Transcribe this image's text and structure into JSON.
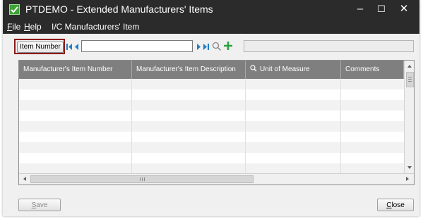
{
  "window": {
    "title": "PTDEMO - Extended Manufacturers' Items",
    "controls": {
      "minimize": "–",
      "maximize": "☐",
      "close": "✕"
    }
  },
  "menu": {
    "file_accel": "F",
    "file_rest": "ile",
    "help_accel": "H",
    "help_rest": "elp",
    "ic": "I/C Manufacturers' Item"
  },
  "toolbar": {
    "key_button": "Item Number",
    "key_value": "",
    "description_value": "",
    "icons": [
      "first-icon",
      "previous-icon",
      "next-icon",
      "last-icon",
      "search-icon",
      "add-icon"
    ]
  },
  "grid": {
    "columns": [
      "Manufacturer's Item Number",
      "Manufacturer's Item Description",
      "Unit of Measure",
      "Comments"
    ],
    "rows": []
  },
  "footer": {
    "save_accel": "S",
    "save_rest": "ave",
    "close_accel": "C",
    "close_rest": "lose"
  },
  "colors": {
    "titlebar": "#2b2b2b",
    "grid_header": "#7f7f7f",
    "highlight_frame": "#8e1a1a",
    "nav_arrow": "#1e7fc4",
    "add_plus": "#2ea043"
  }
}
